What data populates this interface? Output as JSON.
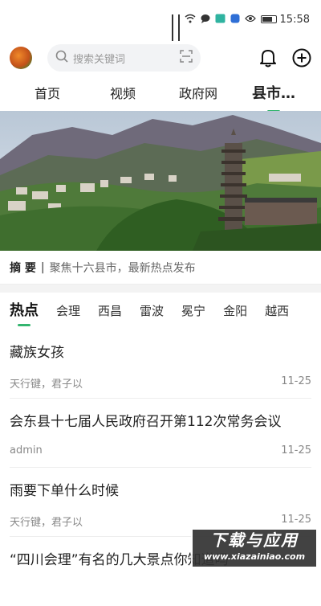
{
  "status_bar": {
    "time": "15:58"
  },
  "header": {
    "search_placeholder": "搜索关键词",
    "icons": [
      "avatar",
      "search-icon",
      "scan-icon",
      "bell-icon",
      "add-icon"
    ]
  },
  "top_tabs": [
    {
      "label": "首页",
      "active": false
    },
    {
      "label": "视频",
      "active": false
    },
    {
      "label": "政府网",
      "active": false
    },
    {
      "label": "县市…",
      "active": true
    }
  ],
  "summary": {
    "label": "摘 要",
    "separator": "|",
    "text": "聚焦十六县市，最新热点发布"
  },
  "categories": [
    {
      "label": "热点",
      "active": true
    },
    {
      "label": "会理",
      "active": false
    },
    {
      "label": "西昌",
      "active": false
    },
    {
      "label": "雷波",
      "active": false
    },
    {
      "label": "冕宁",
      "active": false
    },
    {
      "label": "金阳",
      "active": false
    },
    {
      "label": "越西",
      "active": false
    }
  ],
  "news": [
    {
      "title": "藏族女孩",
      "author": "天行键，君子以",
      "date": "11-25"
    },
    {
      "title": "会东县十七届人民政府召开第112次常务会议",
      "author": "admin",
      "date": "11-25"
    },
    {
      "title": "雨要下单什么时候",
      "author": "天行键，君子以",
      "date": "11-25"
    },
    {
      "title": "“四川会理”有名的几大景点你知道吗",
      "author": "",
      "date": ""
    }
  ],
  "watermark": {
    "line1": "下载与应用",
    "line2": "www.xiazainiao.com"
  },
  "colors": {
    "accent": "#34b56f"
  }
}
